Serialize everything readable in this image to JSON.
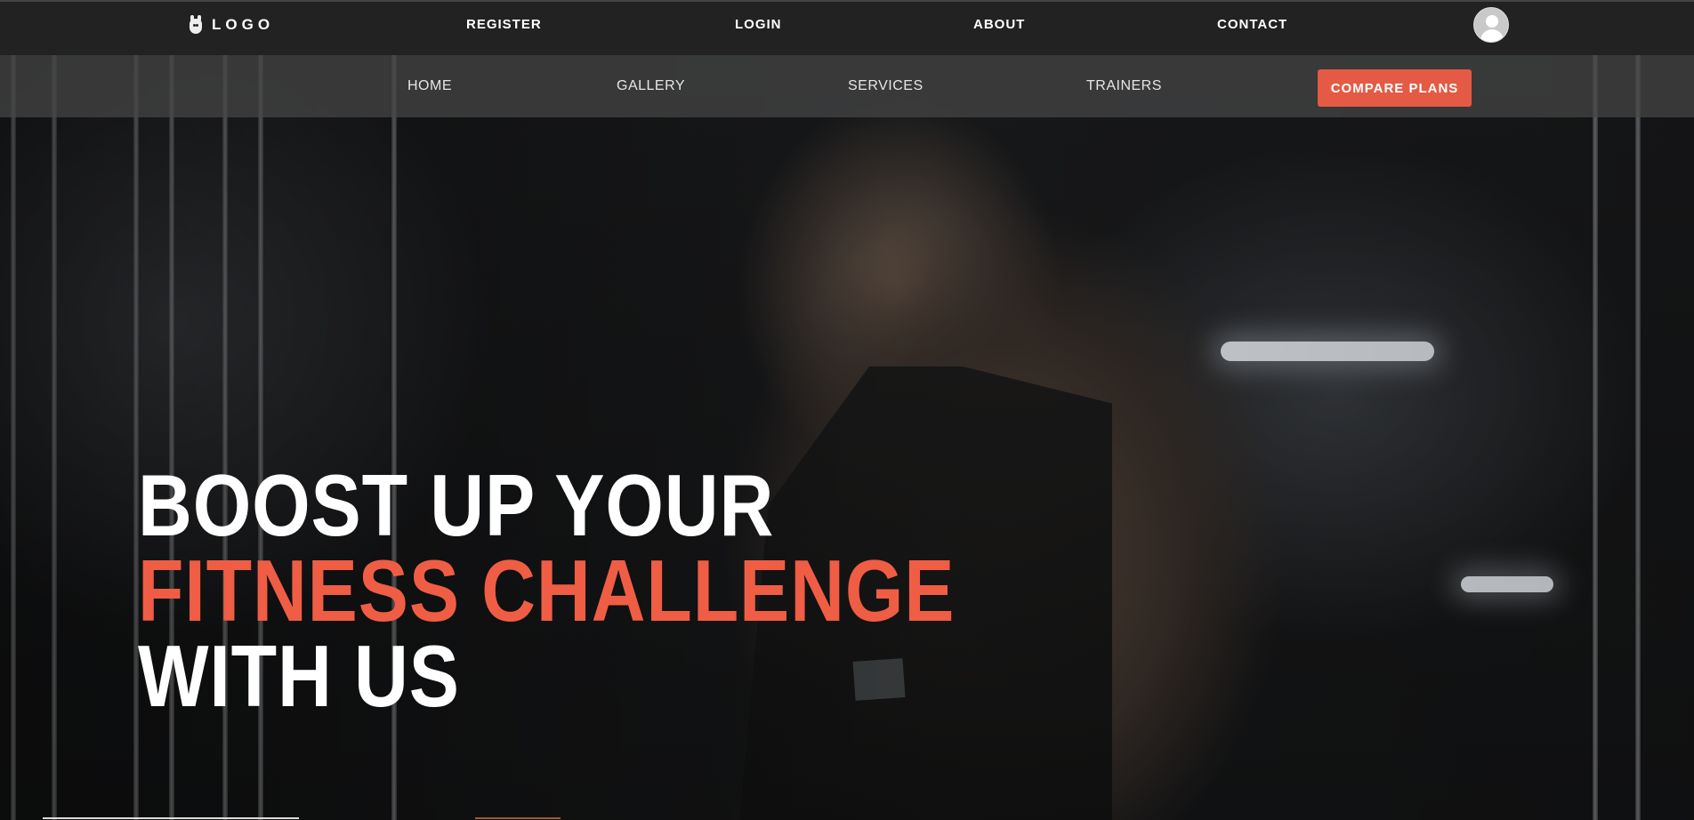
{
  "brand": {
    "logo_text": "LOGO"
  },
  "top_nav": [
    {
      "label": "REGISTER"
    },
    {
      "label": "LOGIN"
    },
    {
      "label": "ABOUT"
    },
    {
      "label": "CONTACT"
    }
  ],
  "sub_nav": [
    {
      "label": "HOME"
    },
    {
      "label": "GALLERY"
    },
    {
      "label": "SERVICES"
    },
    {
      "label": "TRAINERS"
    }
  ],
  "cta": {
    "label": "COMPARE PLANS"
  },
  "hero": {
    "line1": "BOOST UP YOUR",
    "line2": "FITNESS CHALLENGE",
    "line3": "WITH US"
  },
  "colors": {
    "accent": "#e45a45",
    "headline_accent": "#ef5d45",
    "topbar": "#222222"
  },
  "icons": {
    "logo": "android-icon",
    "account": "user-avatar-icon"
  }
}
